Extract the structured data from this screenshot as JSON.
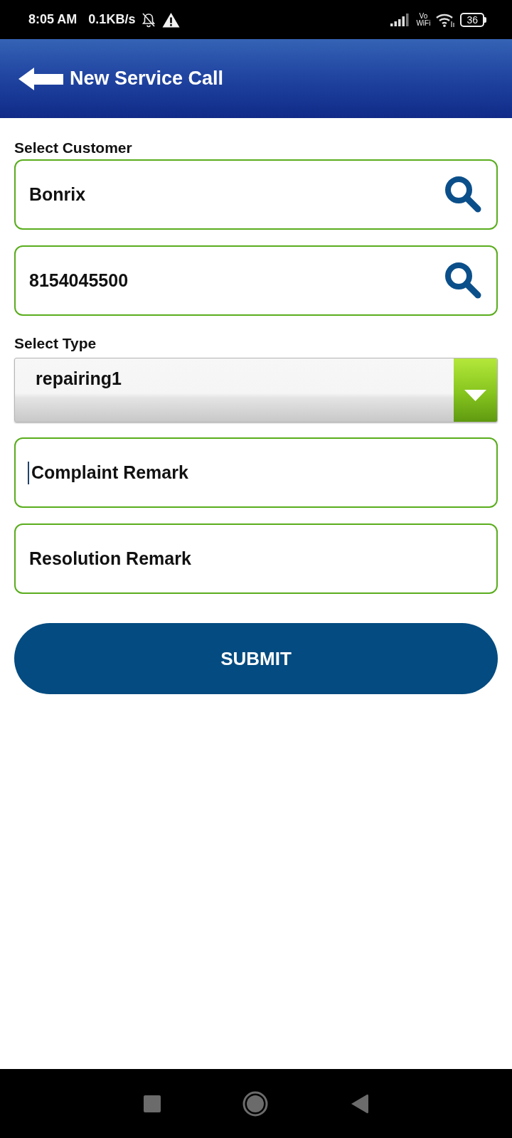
{
  "status_bar": {
    "time": "8:05 AM",
    "speed": "0.1KB/s",
    "vowifi_top": "Vo",
    "vowifi_bottom": "WiFi",
    "battery": "36"
  },
  "header": {
    "title": "New Service Call"
  },
  "form": {
    "customer_label": "Select Customer",
    "customer_fields": [
      {
        "value": "Bonrix"
      },
      {
        "value": "8154045500"
      }
    ],
    "type_label": "Select Type",
    "type_select": {
      "value": "repairing1"
    },
    "remarks": [
      {
        "placeholder": "Complaint Remark",
        "focused": true
      },
      {
        "placeholder": "Resolution Remark",
        "focused": false
      }
    ],
    "submit": "SUBMIT"
  }
}
